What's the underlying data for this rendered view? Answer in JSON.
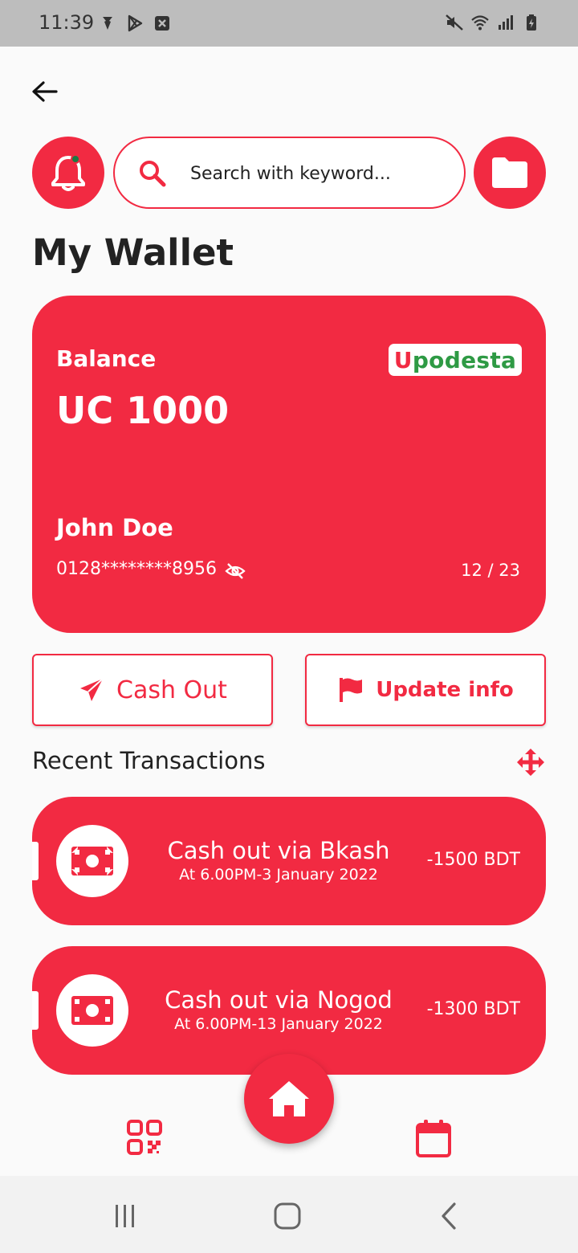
{
  "status_bar": {
    "time": "11:39",
    "left_icons": [
      "notification-icon",
      "play-store-icon",
      "close-box-icon"
    ],
    "right_icons": [
      "mute-icon",
      "wifi-icon",
      "signal-icon",
      "battery-charging-icon"
    ]
  },
  "search": {
    "placeholder": "Search with keyword..."
  },
  "page": {
    "title": "My Wallet"
  },
  "card": {
    "balance_label": "Balance",
    "balance": "UC 1000",
    "brand_first": "U",
    "brand_rest": "podesta",
    "holder": "John Doe",
    "number": "0128********8956",
    "expiry": "12 / 23"
  },
  "actions": {
    "cash_out": "Cash Out",
    "update_info": "Update info"
  },
  "transactions": {
    "title": "Recent Transactions",
    "items": [
      {
        "title": "Cash out via Bkash",
        "subtitle": "At 6.00PM-3 January 2022",
        "amount": "-1500 BDT"
      },
      {
        "title": "Cash out via Nogod",
        "subtitle": "At 6.00PM-13 January 2022",
        "amount": "-1300 BDT"
      }
    ]
  },
  "colors": {
    "accent": "#f22a42",
    "brand_green": "#2e9a44",
    "dot": "#1c7a43"
  }
}
